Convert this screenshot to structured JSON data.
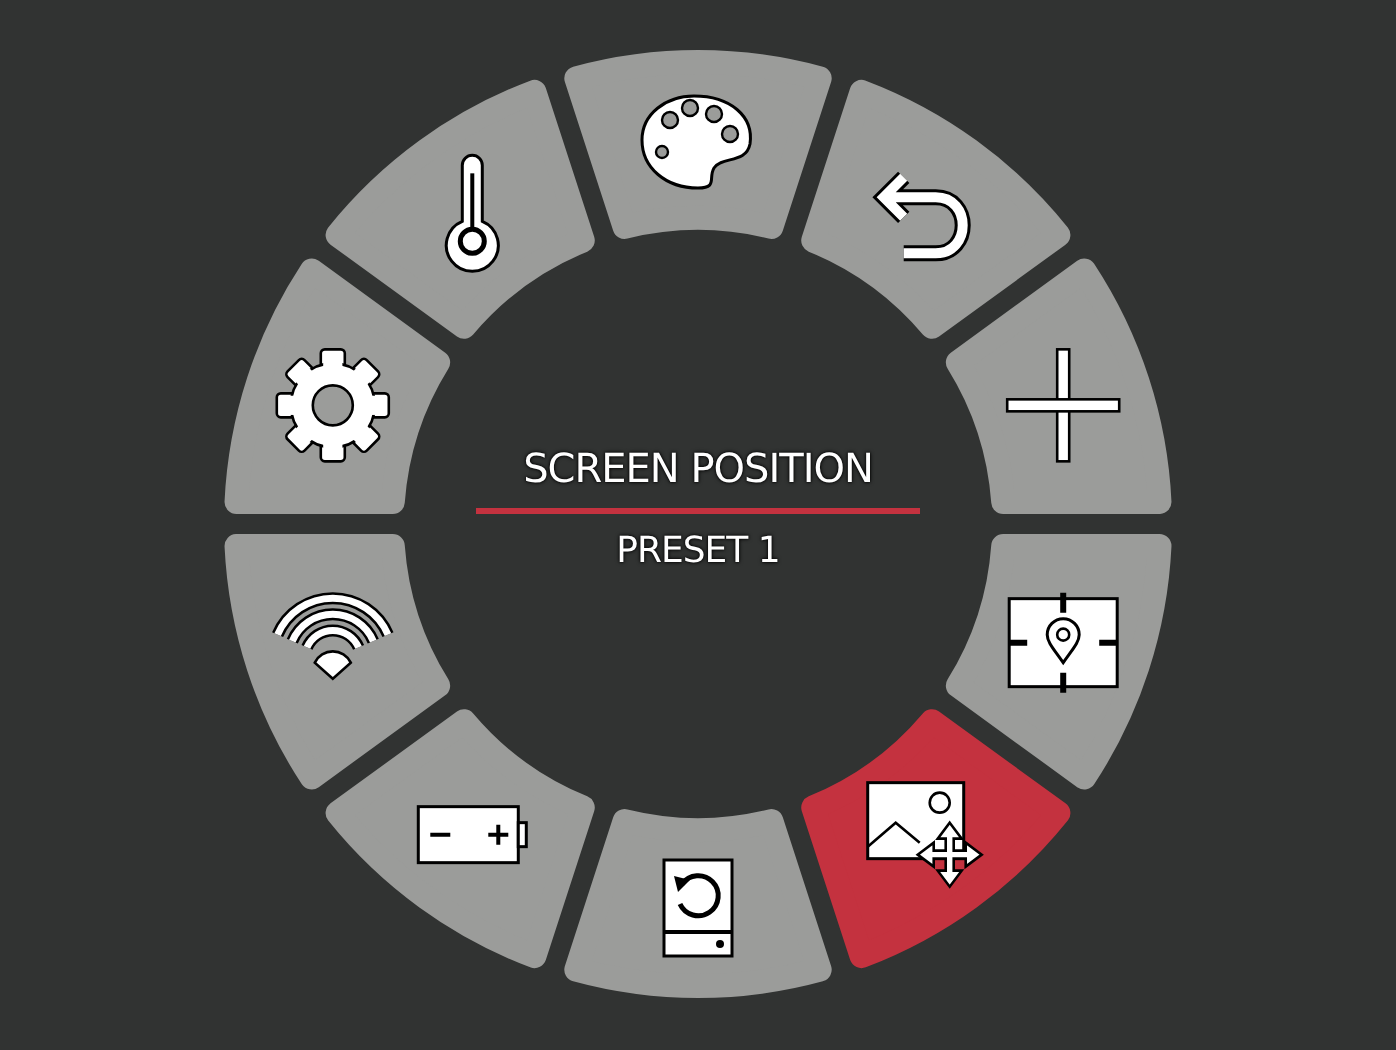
{
  "title": "SCREEN POSITION",
  "subtitle": "PRESET 1",
  "segments": [
    {
      "kind": "palette",
      "selected": false
    },
    {
      "kind": "undo",
      "selected": false
    },
    {
      "kind": "crosshair",
      "selected": false
    },
    {
      "kind": "pin-frame",
      "selected": false
    },
    {
      "kind": "image-move",
      "selected": true
    },
    {
      "kind": "drive-reset",
      "selected": false
    },
    {
      "kind": "battery",
      "selected": false
    },
    {
      "kind": "wifi",
      "selected": false
    },
    {
      "kind": "gear",
      "selected": false
    },
    {
      "kind": "thermometer",
      "selected": false
    }
  ]
}
